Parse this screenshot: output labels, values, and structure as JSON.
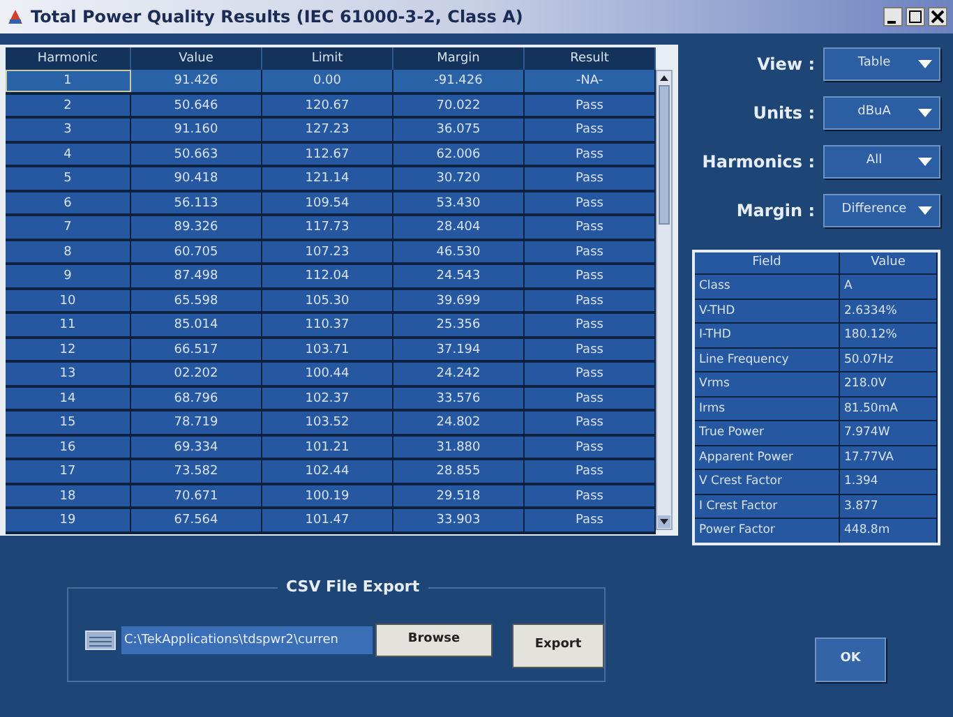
{
  "window": {
    "title": "Total Power Quality Results (IEC 61000-3-2, Class A)"
  },
  "table": {
    "columns": [
      "Harmonic",
      "Value",
      "Limit",
      "Margin",
      "Result"
    ],
    "rows": [
      {
        "cells": [
          "1",
          "91.426",
          "0.00",
          "-91.426",
          "-NA-"
        ],
        "selected": true
      },
      {
        "cells": [
          "2",
          "50.646",
          "120.67",
          "70.022",
          "Pass"
        ],
        "selected": false
      },
      {
        "cells": [
          "3",
          "91.160",
          "127.23",
          "36.075",
          "Pass"
        ],
        "selected": false
      },
      {
        "cells": [
          "4",
          "50.663",
          "112.67",
          "62.006",
          "Pass"
        ],
        "selected": false
      },
      {
        "cells": [
          "5",
          "90.418",
          "121.14",
          "30.720",
          "Pass"
        ],
        "selected": false
      },
      {
        "cells": [
          "6",
          "56.113",
          "109.54",
          "53.430",
          "Pass"
        ],
        "selected": false
      },
      {
        "cells": [
          "7",
          "89.326",
          "117.73",
          "28.404",
          "Pass"
        ],
        "selected": false
      },
      {
        "cells": [
          "8",
          "60.705",
          "107.23",
          "46.530",
          "Pass"
        ],
        "selected": false
      },
      {
        "cells": [
          "9",
          "87.498",
          "112.04",
          "24.543",
          "Pass"
        ],
        "selected": false
      },
      {
        "cells": [
          "10",
          "65.598",
          "105.30",
          "39.699",
          "Pass"
        ],
        "selected": false
      },
      {
        "cells": [
          "11",
          "85.014",
          "110.37",
          "25.356",
          "Pass"
        ],
        "selected": false
      },
      {
        "cells": [
          "12",
          "66.517",
          "103.71",
          "37.194",
          "Pass"
        ],
        "selected": false
      },
      {
        "cells": [
          "13",
          "02.202",
          "100.44",
          "24.242",
          "Pass"
        ],
        "selected": false
      },
      {
        "cells": [
          "14",
          "68.796",
          "102.37",
          "33.576",
          "Pass"
        ],
        "selected": false
      },
      {
        "cells": [
          "15",
          "78.719",
          "103.52",
          "24.802",
          "Pass"
        ],
        "selected": false
      },
      {
        "cells": [
          "16",
          "69.334",
          "101.21",
          "31.880",
          "Pass"
        ],
        "selected": false
      },
      {
        "cells": [
          "17",
          "73.582",
          "102.44",
          "28.855",
          "Pass"
        ],
        "selected": false
      },
      {
        "cells": [
          "18",
          "70.671",
          "100.19",
          "29.518",
          "Pass"
        ],
        "selected": false
      },
      {
        "cells": [
          "19",
          "67.564",
          "101.47",
          "33.903",
          "Pass"
        ],
        "selected": false
      }
    ]
  },
  "options": [
    {
      "label": "View :",
      "value": "Table"
    },
    {
      "label": "Units :",
      "value": "dBuA"
    },
    {
      "label": "Harmonics :",
      "value": "All"
    },
    {
      "label": "Margin :",
      "value": "Difference"
    }
  ],
  "summary": {
    "columns": [
      "Field",
      "Value"
    ],
    "rows": [
      [
        "Class",
        "A"
      ],
      [
        "V-THD",
        "2.6334%"
      ],
      [
        "I-THD",
        "180.12%"
      ],
      [
        "Line Frequency",
        "50.07Hz"
      ],
      [
        "Vrms",
        "218.0V"
      ],
      [
        "Irms",
        "81.50mA"
      ],
      [
        "True Power",
        "7.974W"
      ],
      [
        "Apparent Power",
        "17.77VA"
      ],
      [
        "V Crest Factor",
        "1.394"
      ],
      [
        "I Crest Factor",
        "3.877"
      ],
      [
        "Power Factor",
        "448.8m"
      ]
    ]
  },
  "export": {
    "title": "CSV File Export",
    "path": "C:\\TekApplications\\tdspwr2\\curren",
    "browse": "Browse",
    "export": "Export"
  },
  "ok": "OK"
}
